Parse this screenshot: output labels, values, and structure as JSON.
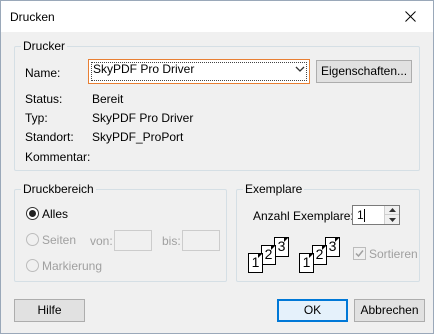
{
  "window": {
    "title": "Drucken"
  },
  "printer": {
    "legend": "Drucker",
    "name_label": "Name:",
    "name_value": "SkyPDF Pro Driver",
    "properties_button": "Eigenschaften...",
    "status_label": "Status:",
    "status_value": "Bereit",
    "type_label": "Typ:",
    "type_value": "SkyPDF Pro Driver",
    "location_label": "Standort:",
    "location_value": "SkyPDF_ProPort",
    "comment_label": "Kommentar:",
    "comment_value": ""
  },
  "range": {
    "legend": "Druckbereich",
    "all_label": "Alles",
    "pages_label": "Seiten",
    "from_label": "von:",
    "to_label": "bis:",
    "from_value": "",
    "to_value": "",
    "selection_label": "Markierung",
    "selected": "all"
  },
  "copies": {
    "legend": "Exemplare",
    "count_label": "Anzahl Exemplare:",
    "count_value": "1",
    "collate_label": "Sortieren",
    "collate_checked": true,
    "page_numbers": [
      "1",
      "2",
      "3"
    ]
  },
  "buttons": {
    "help": "Hilfe",
    "ok": "OK",
    "cancel": "Abbrechen"
  }
}
